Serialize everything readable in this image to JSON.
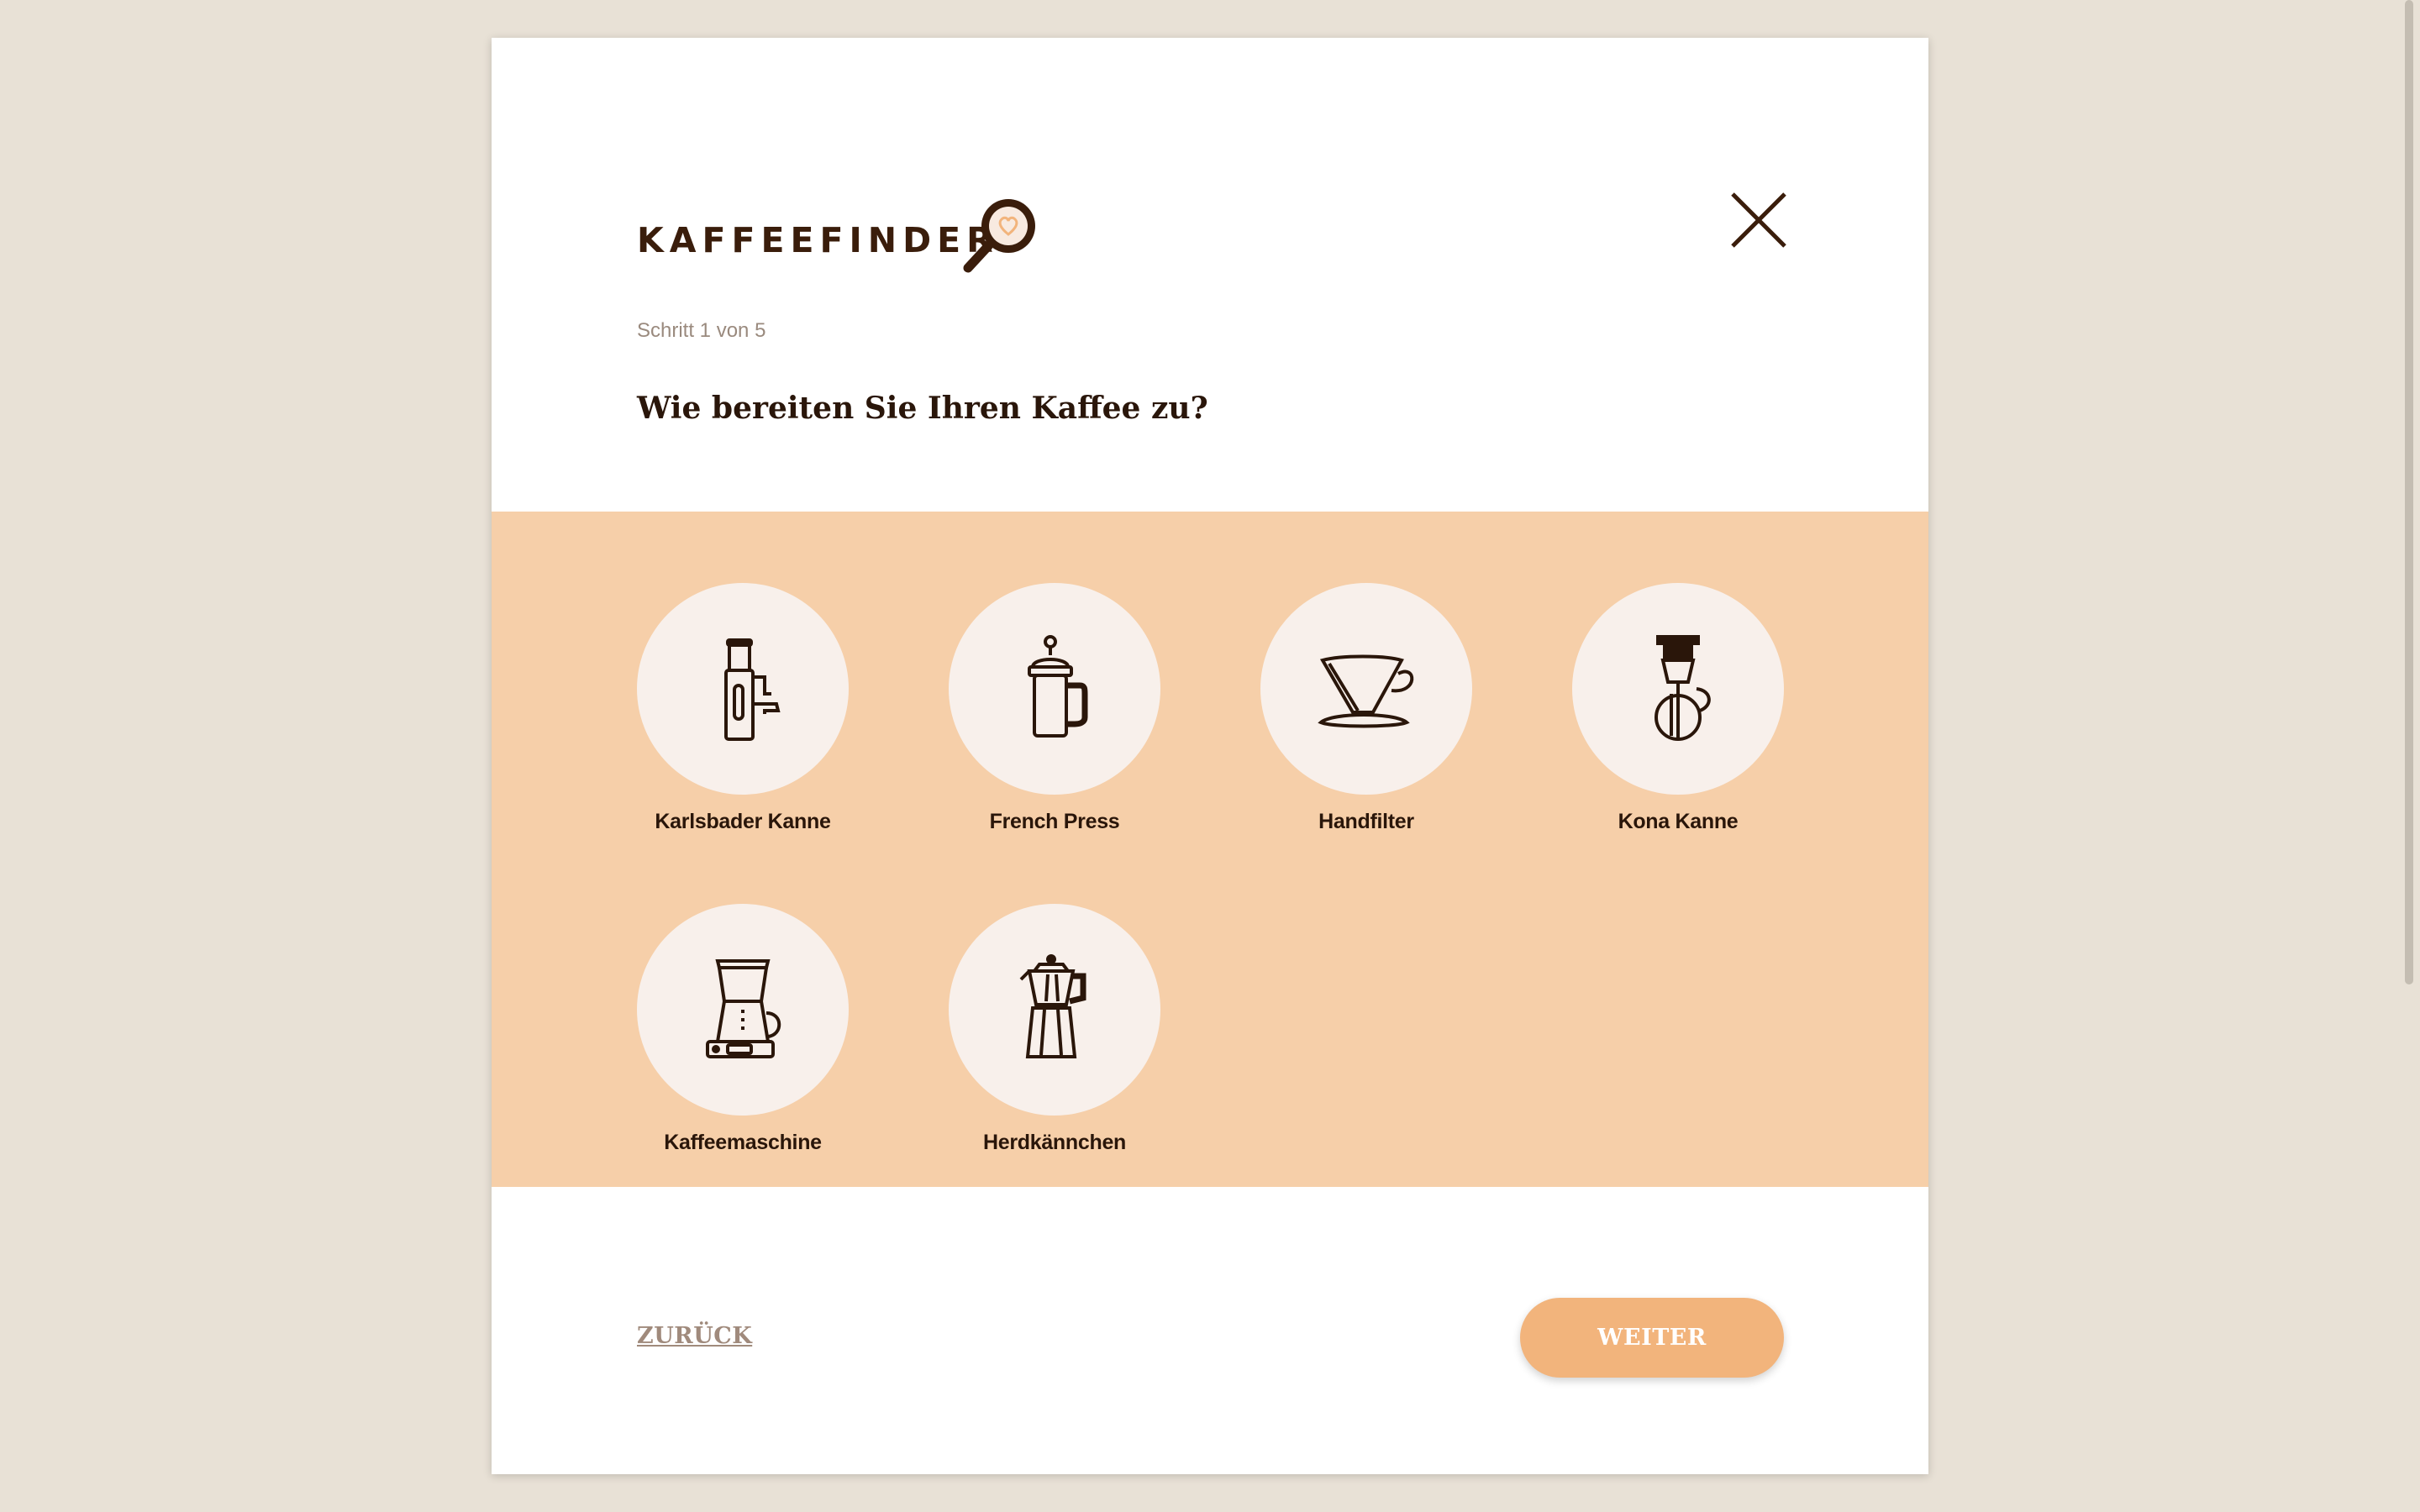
{
  "colors": {
    "background": "#e8e1d6",
    "accent": "#f2b47c",
    "band": "#f6cfa9",
    "text_dark": "#2a160a"
  },
  "header": {
    "brand": "KAFFEEFINDER",
    "logo_icon": "magnifier-heart-icon",
    "close_icon": "close-icon"
  },
  "step": "Schritt 1 von 5",
  "question": "Wie bereiten Sie Ihren Kaffee zu?",
  "options": [
    {
      "label": "Karlsbader Kanne",
      "icon": "karlsbader-kanne-icon"
    },
    {
      "label": "French Press",
      "icon": "french-press-icon"
    },
    {
      "label": "Handfilter",
      "icon": "handfilter-icon"
    },
    {
      "label": "Kona Kanne",
      "icon": "kona-kanne-icon"
    },
    {
      "label": "Kaffeemaschine",
      "icon": "kaffeemaschine-icon"
    },
    {
      "label": "Herdkännchen",
      "icon": "herdkaennchen-icon"
    }
  ],
  "footer": {
    "back_label": "ZURÜCK",
    "next_label": "WEITER"
  }
}
